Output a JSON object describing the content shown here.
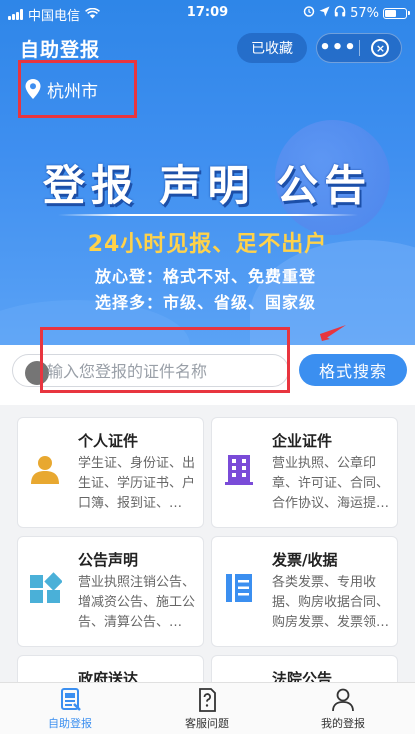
{
  "status_bar": {
    "carrier": "中国电信",
    "time": "17:09",
    "battery": "57%",
    "battery_level": 0.57
  },
  "header": {
    "title": "自助登报",
    "favorite_label": "已收藏",
    "more_icon": "more-dots-icon",
    "close_icon": "close-circle-icon"
  },
  "location": {
    "city": "杭州市"
  },
  "banner": {
    "headline": "登报 声明 公告",
    "slogan": "24小时见报、足不出户",
    "features": [
      "放心登：格式不对、免费重登",
      "选择多：市级、省级、国家级"
    ]
  },
  "search": {
    "placeholder": "输入您登报的证件名称",
    "button_label": "格式搜索"
  },
  "categories": [
    {
      "title": "个人证件",
      "desc": "学生证、身份证、出生证、学历证书、户口簿、报到证、…",
      "icon": "person-icon",
      "color": "#e8a830"
    },
    {
      "title": "企业证件",
      "desc": "营业执照、公章印章、许可证、合同、合作协议、海运提…",
      "icon": "building-icon",
      "color": "#7a4bd8"
    },
    {
      "title": "公告声明",
      "desc": "营业执照注销公告、增减资公告、施工公告、清算公告、…",
      "icon": "blocks-icon",
      "color": "#4ab0d8"
    },
    {
      "title": "发票/收据",
      "desc": "各类发票、专用收据、购房收据合同、购房发票、发票领…",
      "icon": "invoice-icon",
      "color": "#3b8ff0"
    },
    {
      "title": "政府送达",
      "desc": "",
      "icon": "government-icon",
      "color": "#e8a830"
    },
    {
      "title": "法院公告",
      "desc": "",
      "icon": "court-icon",
      "color": "#3b8ff0"
    }
  ],
  "tabbar": {
    "items": [
      {
        "label": "自助登报",
        "icon": "newspaper-icon",
        "active": true
      },
      {
        "label": "客服问题",
        "icon": "question-doc-icon",
        "active": false
      },
      {
        "label": "我的登报",
        "icon": "user-icon",
        "active": false
      }
    ]
  },
  "colors": {
    "primary": "#3b8ff0",
    "highlight_red": "#e8353f",
    "slogan_yellow": "#ffd24a"
  }
}
